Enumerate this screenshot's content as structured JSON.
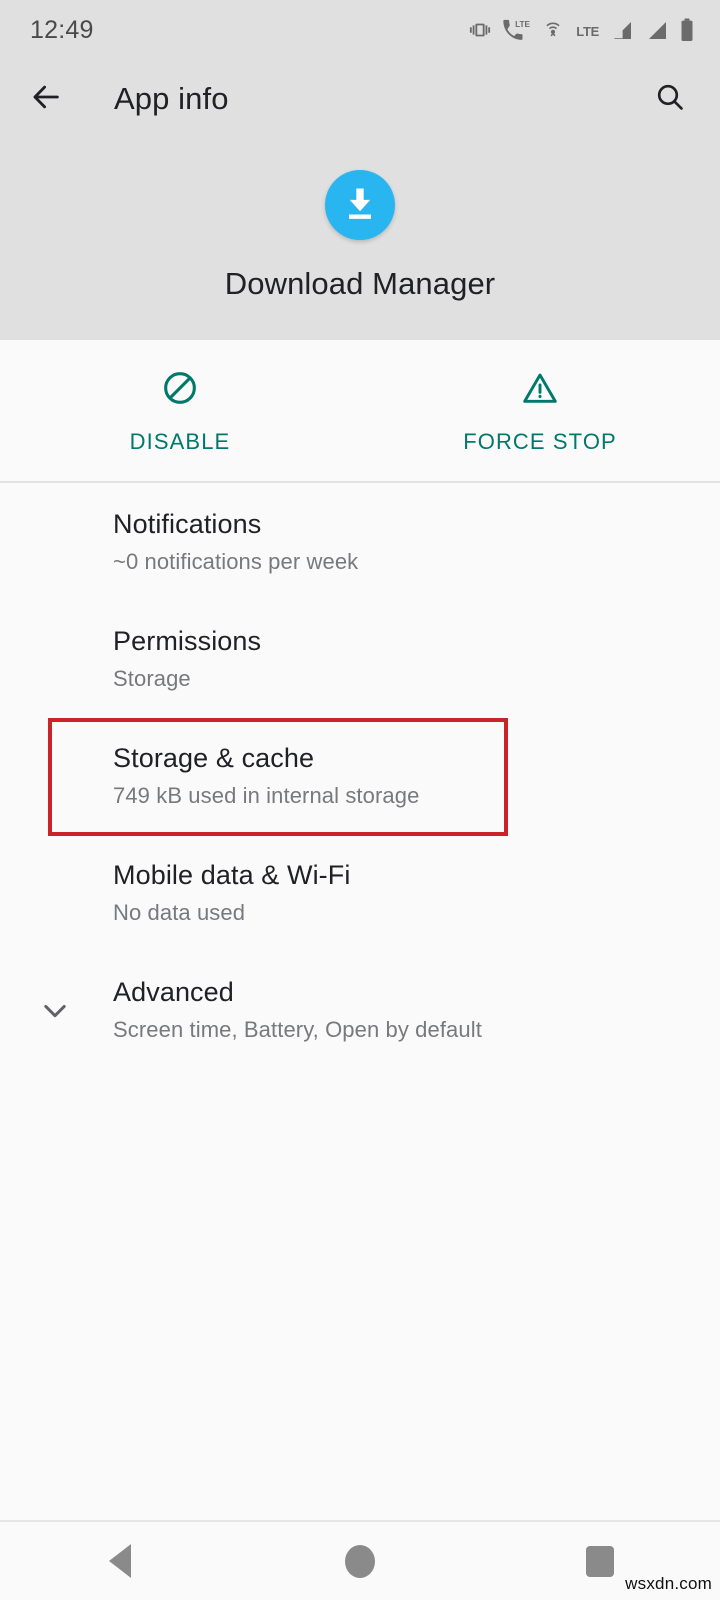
{
  "status_bar": {
    "clock": "12:49",
    "icons": [
      {
        "name": "vibrate-icon"
      },
      {
        "name": "volte-call-icon"
      },
      {
        "name": "hotspot-icon"
      },
      {
        "name": "lte-label-icon",
        "label": "LTE"
      },
      {
        "name": "signal-bars-sim1-icon"
      },
      {
        "name": "signal-bars-sim2-icon"
      },
      {
        "name": "battery-icon"
      }
    ]
  },
  "action_bar": {
    "back_icon": "back-arrow-icon",
    "title": "App info",
    "search_icon": "search-icon"
  },
  "app": {
    "icon_name": "download-manager-icon",
    "icon_color": "#29b6f0",
    "name": "Download Manager"
  },
  "actions": [
    {
      "icon": "block-circle-slash-icon",
      "label": "DISABLE"
    },
    {
      "icon": "warning-triangle-icon",
      "label": "FORCE STOP"
    }
  ],
  "accent_color": "#00796b",
  "highlight_color": "#cc2229",
  "settings": [
    {
      "key": "notifications",
      "title": "Notifications",
      "subtitle": "~0 notifications per week",
      "highlighted": false
    },
    {
      "key": "permissions",
      "title": "Permissions",
      "subtitle": "Storage",
      "highlighted": false
    },
    {
      "key": "storage-cache",
      "title": "Storage & cache",
      "subtitle": "749 kB used in internal storage",
      "highlighted": true
    },
    {
      "key": "mobile-data-wifi",
      "title": "Mobile data & Wi-Fi",
      "subtitle": "No data used",
      "highlighted": false
    },
    {
      "key": "advanced",
      "title": "Advanced",
      "subtitle": "Screen time, Battery, Open by default",
      "highlighted": false,
      "chevron": "chevron-down-icon"
    }
  ],
  "nav_bar": {
    "back": "nav-back-icon",
    "home": "nav-home-icon",
    "recents": "nav-recents-icon"
  },
  "watermark": "wsxdn.com"
}
